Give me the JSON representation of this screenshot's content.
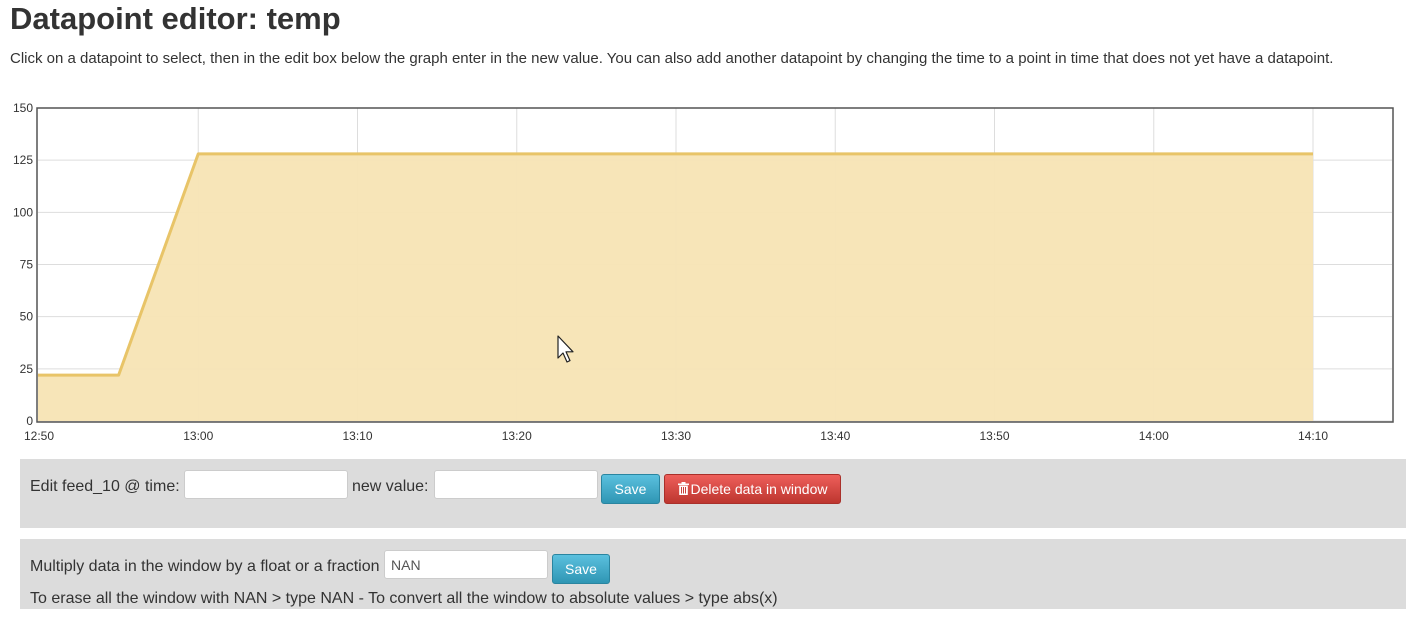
{
  "page": {
    "title": "Datapoint editor: temp",
    "description": "Click on a datapoint to select, then in the edit box below the graph enter in the new value. You can also add another datapoint by changing the time to a point in time that does not yet have a datapoint."
  },
  "chart_data": {
    "type": "area",
    "x": [
      "12:50",
      "12:55",
      "13:00",
      "14:10"
    ],
    "values": [
      22,
      22,
      128,
      128
    ],
    "x_ticks": [
      "12:50",
      "13:00",
      "13:10",
      "13:20",
      "13:30",
      "13:40",
      "13:50",
      "14:00",
      "14:10"
    ],
    "y_ticks": [
      "0",
      "25",
      "50",
      "75",
      "100",
      "125",
      "150"
    ],
    "ylim": [
      0,
      150
    ],
    "grid": true,
    "colors": {
      "line": "#e8c468",
      "fill": "#f7e4b4",
      "grid": "#dddddd",
      "frame": "#545454"
    }
  },
  "edit": {
    "label_prefix": "Edit feed_10 @ time:",
    "time_value": "",
    "new_value_label": "new value:",
    "new_value": "",
    "save_label": "Save",
    "delete_label": "Delete data in window"
  },
  "multiply": {
    "label": "Multiply data in the window by a float or a fraction",
    "value": "NAN",
    "save_label": "Save",
    "help": "To erase all the window with NAN > type NAN - To convert all the window to absolute values > type abs(x)"
  },
  "colors": {
    "panel": "#dcdcdc",
    "save": "#49afcd",
    "delete": "#da4f49"
  }
}
